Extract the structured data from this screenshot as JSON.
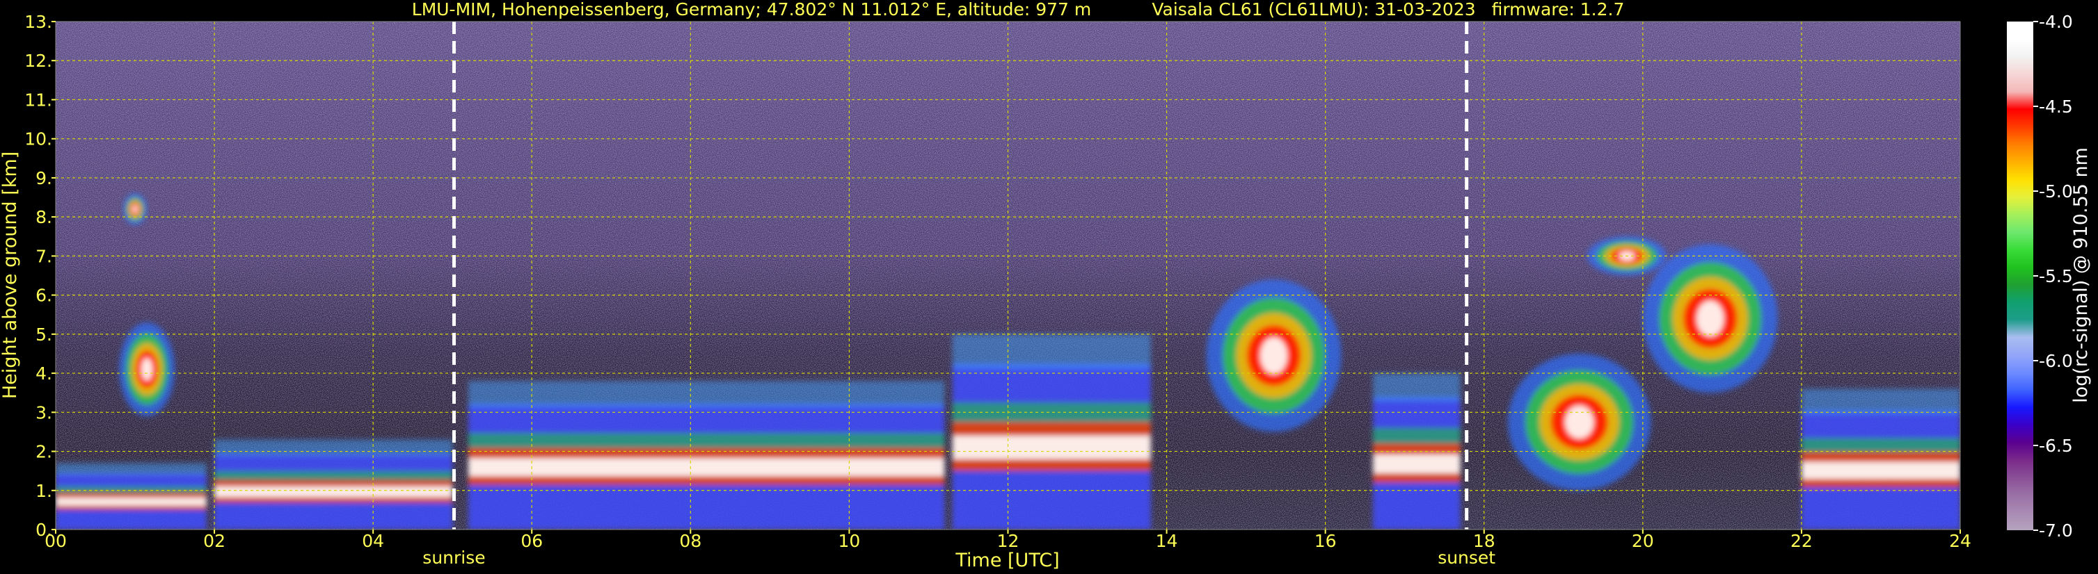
{
  "title": {
    "site": "LMU-MIM, Hohenpeissenberg, Germany; 47.802° N 11.012° E, altitude: 977 m",
    "instrument": "Vaisala CL61 (CL61LMU): 31-03-2023",
    "firmware": "firmware: 1.2.7"
  },
  "chart_data": {
    "type": "heatmap",
    "xlabel": "Time [UTC]",
    "ylabel": "Height above ground [km]",
    "xlim": [
      0,
      24
    ],
    "ylim": [
      0,
      13
    ],
    "x_ticks": [
      "00",
      "02",
      "04",
      "06",
      "08",
      "10",
      "12",
      "14",
      "16",
      "18",
      "20",
      "22",
      "24"
    ],
    "y_ticks": [
      "0.",
      "1.",
      "2.",
      "3.",
      "4.",
      "5.",
      "6.",
      "7.",
      "8.",
      "9.",
      "10.",
      "11.",
      "12.",
      "13."
    ],
    "grid": true,
    "events": [
      {
        "label": "sunrise",
        "time_utc": 5.02
      },
      {
        "label": "sunset",
        "time_utc": 17.78
      }
    ],
    "colorbar": {
      "label": "log(rc-signal) @ 910.55 nm",
      "range": [
        -7.0,
        -4.0
      ],
      "ticks": [
        "-4.0",
        "-4.5",
        "-5.0",
        "-5.5",
        "-6.0",
        "-6.5",
        "-7.0"
      ],
      "colors": [
        "#b5a4bf",
        "#a98ab3",
        "#9a70a6",
        "#8a4f97",
        "#7a2a8a",
        "#5a0090",
        "#3a00c8",
        "#1818ff",
        "#3f63ff",
        "#6f8cff",
        "#93a6f8",
        "#a9bdf0",
        "#1e9d8a",
        "#10a070",
        "#20a030",
        "#1fc21f",
        "#39dc39",
        "#6ee86e",
        "#a5f05a",
        "#e6f03a",
        "#ffe000",
        "#ffb000",
        "#ff7f00",
        "#ff3c00",
        "#ff0000",
        "#f4b8b8",
        "#f6d6d6",
        "#f2f2f2",
        "#ffffff",
        "#ffffff"
      ]
    },
    "cloud_features": [
      {
        "t0": 0.0,
        "t1": 1.9,
        "base_km": 0.0,
        "top_km": 1.7,
        "kind": "boundary layer"
      },
      {
        "t0": 0.8,
        "t1": 1.5,
        "base_km": 2.9,
        "top_km": 5.3,
        "kind": "cloud"
      },
      {
        "t0": 0.85,
        "t1": 1.15,
        "base_km": 7.8,
        "top_km": 8.6,
        "kind": "cloud"
      },
      {
        "t0": 2.0,
        "t1": 5.0,
        "base_km": 0.0,
        "top_km": 2.3,
        "kind": "boundary layer"
      },
      {
        "t0": 5.2,
        "t1": 11.2,
        "base_km": 0.0,
        "top_km": 3.8,
        "kind": "boundary layer"
      },
      {
        "t0": 11.3,
        "t1": 13.8,
        "base_km": 0.0,
        "top_km": 5.0,
        "kind": "boundary layer"
      },
      {
        "t0": 14.5,
        "t1": 16.2,
        "base_km": 2.5,
        "top_km": 6.4,
        "kind": "cloud"
      },
      {
        "t0": 16.6,
        "t1": 17.7,
        "base_km": 0.0,
        "top_km": 4.0,
        "kind": "boundary layer"
      },
      {
        "t0": 18.3,
        "t1": 20.1,
        "base_km": 1.0,
        "top_km": 4.5,
        "kind": "cloud"
      },
      {
        "t0": 19.3,
        "t1": 20.3,
        "base_km": 6.5,
        "top_km": 7.5,
        "kind": "cloud"
      },
      {
        "t0": 20.0,
        "t1": 21.7,
        "base_km": 3.5,
        "top_km": 7.3,
        "kind": "cloud"
      },
      {
        "t0": 22.0,
        "t1": 24.0,
        "base_km": 0.0,
        "top_km": 3.6,
        "kind": "boundary layer"
      }
    ]
  }
}
